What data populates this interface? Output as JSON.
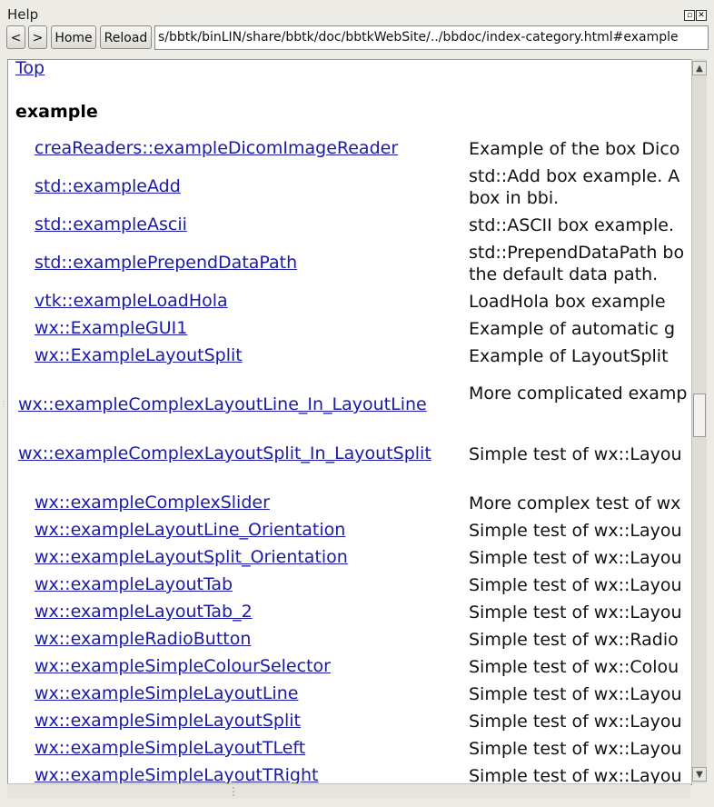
{
  "window": {
    "title": "Help"
  },
  "toolbar": {
    "back_label": "<",
    "forward_label": ">",
    "home_label": "Home",
    "reload_label": "Reload",
    "url_value": "s/bbtk/binLIN/share/bbtk/doc/bbtkWebSite/../bbdoc/index-category.html#example"
  },
  "page": {
    "top_link": "Top",
    "heading": "example",
    "rows": [
      {
        "name": "creaReaders::exampleDicomImageReader",
        "desc": [
          "Example of the box Dico"
        ]
      },
      {
        "name": "std::exampleAdd",
        "desc": [
          "std::Add box example. A",
          "box in bbi."
        ]
      },
      {
        "name": "std::exampleAscii",
        "desc": [
          "std::ASCII box example."
        ]
      },
      {
        "name": "std::examplePrependDataPath",
        "desc": [
          "std::PrependDataPath bo",
          "the default data path."
        ]
      },
      {
        "name": "vtk::exampleLoadHola",
        "desc": [
          "LoadHola box example"
        ]
      },
      {
        "name": "wx::ExampleGUI1",
        "desc": [
          "Example of automatic g"
        ]
      },
      {
        "name": "wx::ExampleLayoutSplit",
        "desc": [
          "Example of LayoutSplit"
        ]
      },
      {
        "name": "wx::exampleComplexLayoutLine_In_LayoutLine",
        "desc": [
          "More complicated examp"
        ]
      },
      {
        "name": "wx::exampleComplexLayoutSplit_In_LayoutSplit",
        "desc": [
          "Simple test of wx::Layou"
        ]
      },
      {
        "name": "wx::exampleComplexSlider",
        "desc": [
          "More complex test of wx"
        ]
      },
      {
        "name": "wx::exampleLayoutLine_Orientation",
        "desc": [
          "Simple test of wx::Layou"
        ]
      },
      {
        "name": "wx::exampleLayoutSplit_Orientation",
        "desc": [
          "Simple test of wx::Layou"
        ]
      },
      {
        "name": "wx::exampleLayoutTab",
        "desc": [
          "Simple test of wx::Layou"
        ]
      },
      {
        "name": "wx::exampleLayoutTab_2",
        "desc": [
          "Simple test of wx::Layou"
        ]
      },
      {
        "name": "wx::exampleRadioButton",
        "desc": [
          "Simple test of wx::Radio"
        ]
      },
      {
        "name": "wx::exampleSimpleColourSelector",
        "desc": [
          "Simple test of wx::Colou"
        ]
      },
      {
        "name": "wx::exampleSimpleLayoutLine",
        "desc": [
          "Simple test of wx::Layou"
        ]
      },
      {
        "name": "wx::exampleSimpleLayoutSplit",
        "desc": [
          "Simple test of wx::Layou"
        ]
      },
      {
        "name": "wx::exampleSimpleLayoutTLeft",
        "desc": [
          "Simple test of wx::Layou"
        ]
      },
      {
        "name": "wx::exampleSimpleLayoutTRight",
        "desc": [
          "Simple test of wx::Layou"
        ]
      }
    ]
  },
  "scrollbar": {
    "position_fraction": 0.48
  }
}
